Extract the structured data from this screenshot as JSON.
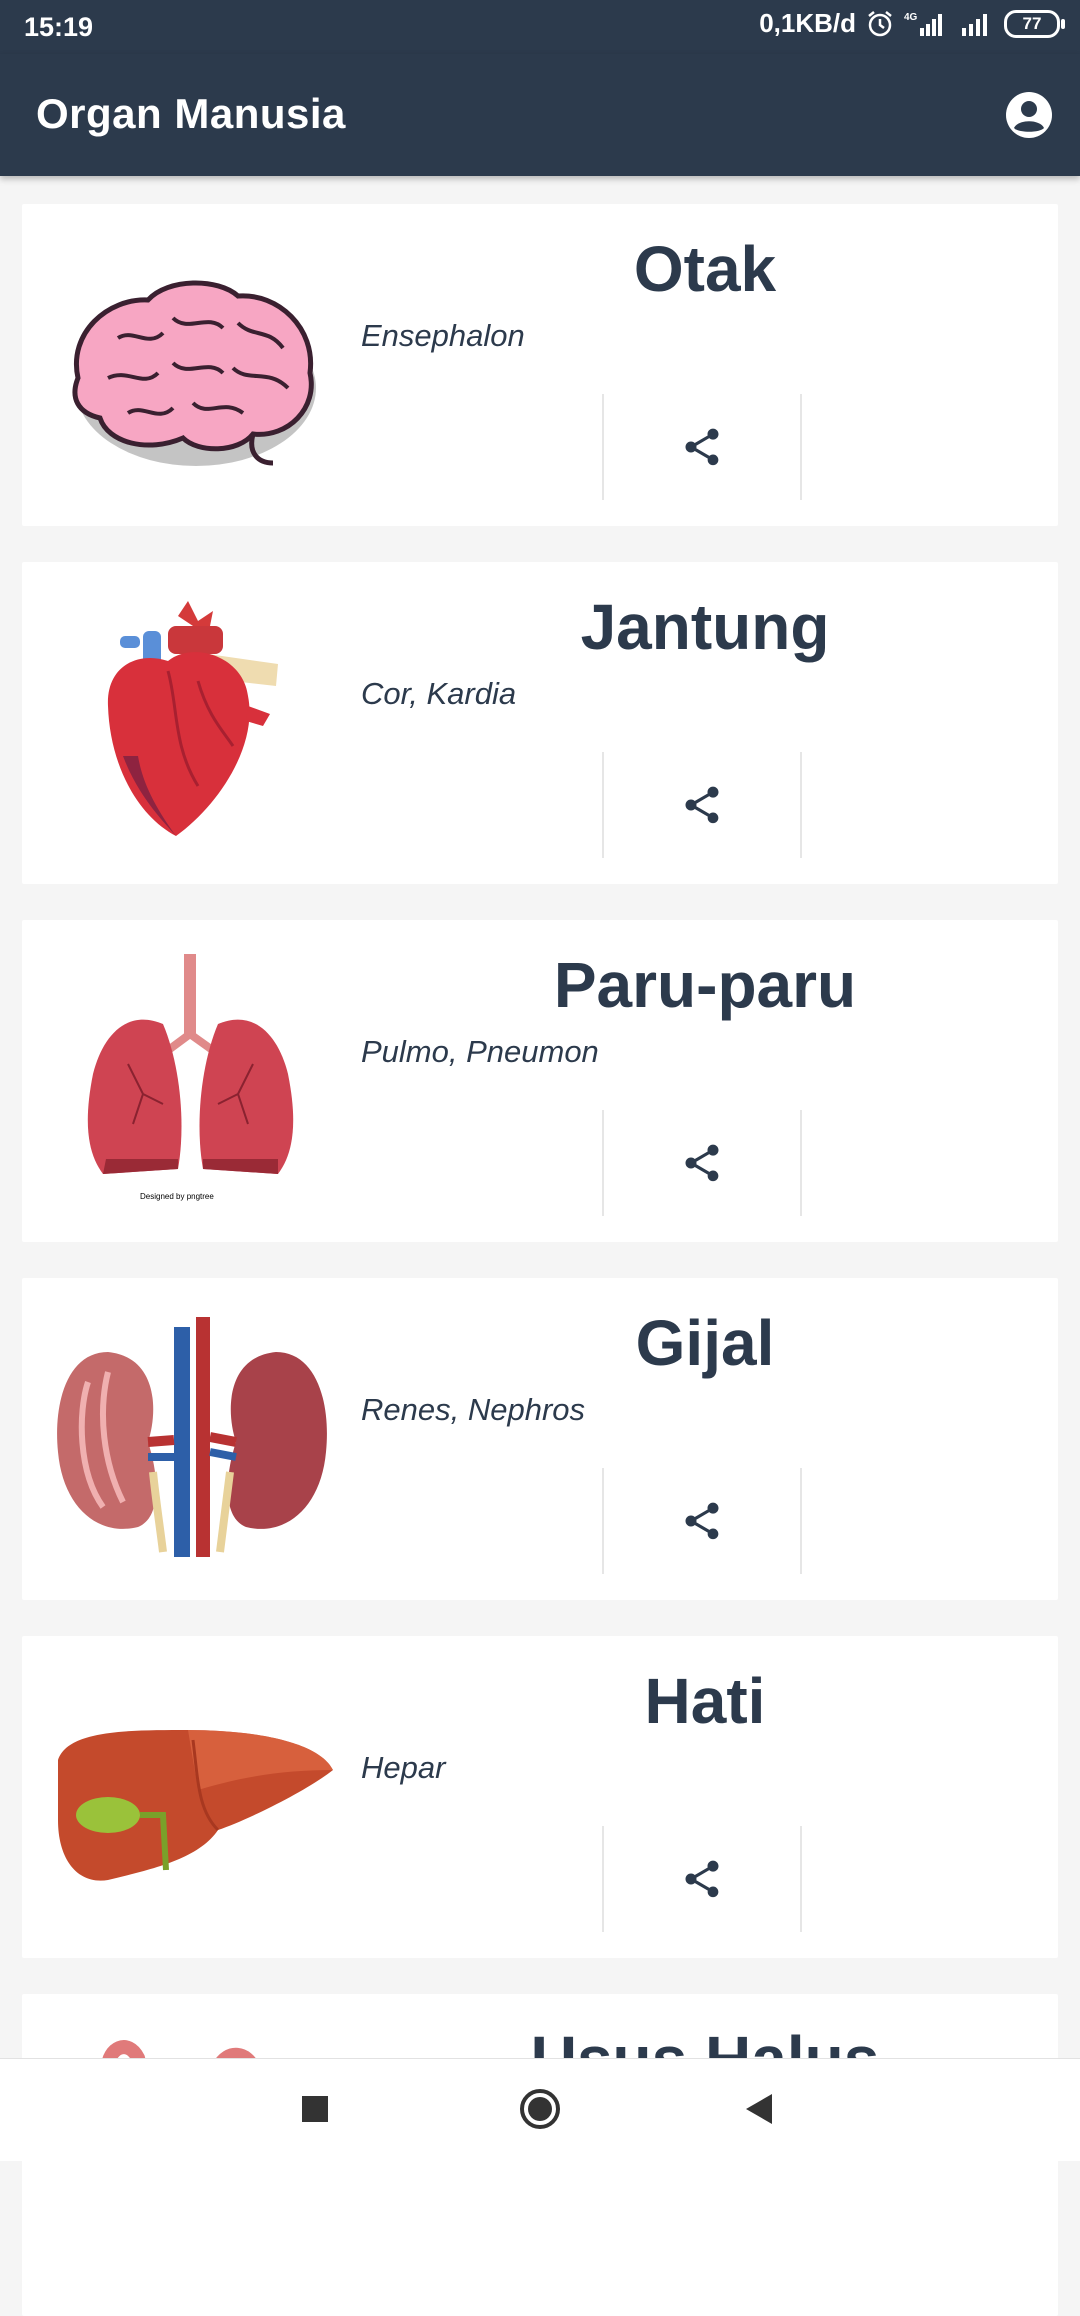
{
  "status_bar": {
    "time": "15:19",
    "speed": "0,1KB/d",
    "network": "4G",
    "battery": "77"
  },
  "app_bar": {
    "title": "Organ Manusia",
    "account_icon": "account-circle-icon"
  },
  "organs": [
    {
      "name": "Otak",
      "latin": "Ensephalon",
      "image": "brain"
    },
    {
      "name": "Jantung",
      "latin": "Cor, Kardia",
      "image": "heart"
    },
    {
      "name": "Paru-paru",
      "latin": "Pulmo, Pneumon",
      "image": "lungs",
      "watermark": "Designed by pngtree"
    },
    {
      "name": "Gijal",
      "latin": "Renes, Nephros",
      "image": "kidneys"
    },
    {
      "name": "Hati",
      "latin": "Hepar",
      "image": "liver"
    },
    {
      "name": "Usus Halus",
      "latin": "",
      "image": "intestine"
    }
  ],
  "share_icon": "share-icon",
  "nav_bar": {
    "recents": "square-icon",
    "home": "circle-icon",
    "back": "triangle-back-icon"
  },
  "colors": {
    "primary": "#2c3a4c",
    "background": "#f5f5f5",
    "card": "#ffffff"
  }
}
